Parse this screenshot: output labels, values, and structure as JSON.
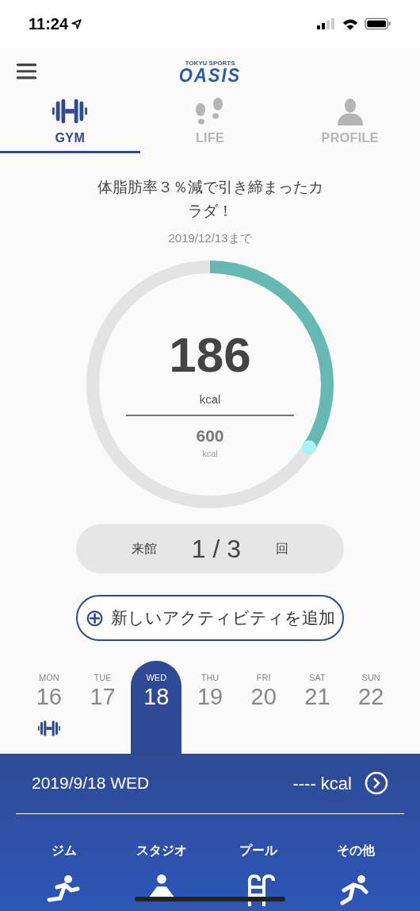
{
  "status_bar": {
    "time": "11:24"
  },
  "header": {
    "logo_top": "TOKYU SPORTS",
    "logo_main": "OASIS"
  },
  "tabs": [
    {
      "label": "GYM",
      "kind": "gym",
      "selected": true
    },
    {
      "label": "LIFE",
      "kind": "life",
      "selected": false
    },
    {
      "label": "PROFILE",
      "kind": "profile",
      "selected": false
    }
  ],
  "goal": {
    "title": "体脂肪率３％減で引き締まったカラダ！",
    "deadline": "2019/12/13まで"
  },
  "progress": {
    "value": "186",
    "unit": "kcal",
    "target": "600",
    "target_unit": "kcal",
    "level": 0.34
  },
  "visits": {
    "label": "来館",
    "count": "1 / 3",
    "unit": "回"
  },
  "add_button": {
    "icon": "⊕",
    "label": "新しいアクティビティを追加"
  },
  "week": [
    {
      "weekday": "MON",
      "day": "16",
      "selected": false,
      "gym_logged": true
    },
    {
      "weekday": "TUE",
      "day": "17",
      "selected": false,
      "gym_logged": false
    },
    {
      "weekday": "WED",
      "day": "18",
      "selected": true,
      "gym_logged": false
    },
    {
      "weekday": "THU",
      "day": "19",
      "selected": false,
      "gym_logged": false
    },
    {
      "weekday": "FRI",
      "day": "20",
      "selected": false,
      "gym_logged": false
    },
    {
      "weekday": "SAT",
      "day": "21",
      "selected": false,
      "gym_logged": false
    },
    {
      "weekday": "SUN",
      "day": "22",
      "selected": false,
      "gym_logged": false
    }
  ],
  "day_panel": {
    "date": "2019/9/18 WED",
    "kcal": "---- kcal",
    "categories": [
      {
        "label": "ジム",
        "kind": "gym"
      },
      {
        "label": "スタジオ",
        "kind": "studio"
      },
      {
        "label": "プール",
        "kind": "pool"
      },
      {
        "label": "その他",
        "kind": "other"
      }
    ]
  }
}
